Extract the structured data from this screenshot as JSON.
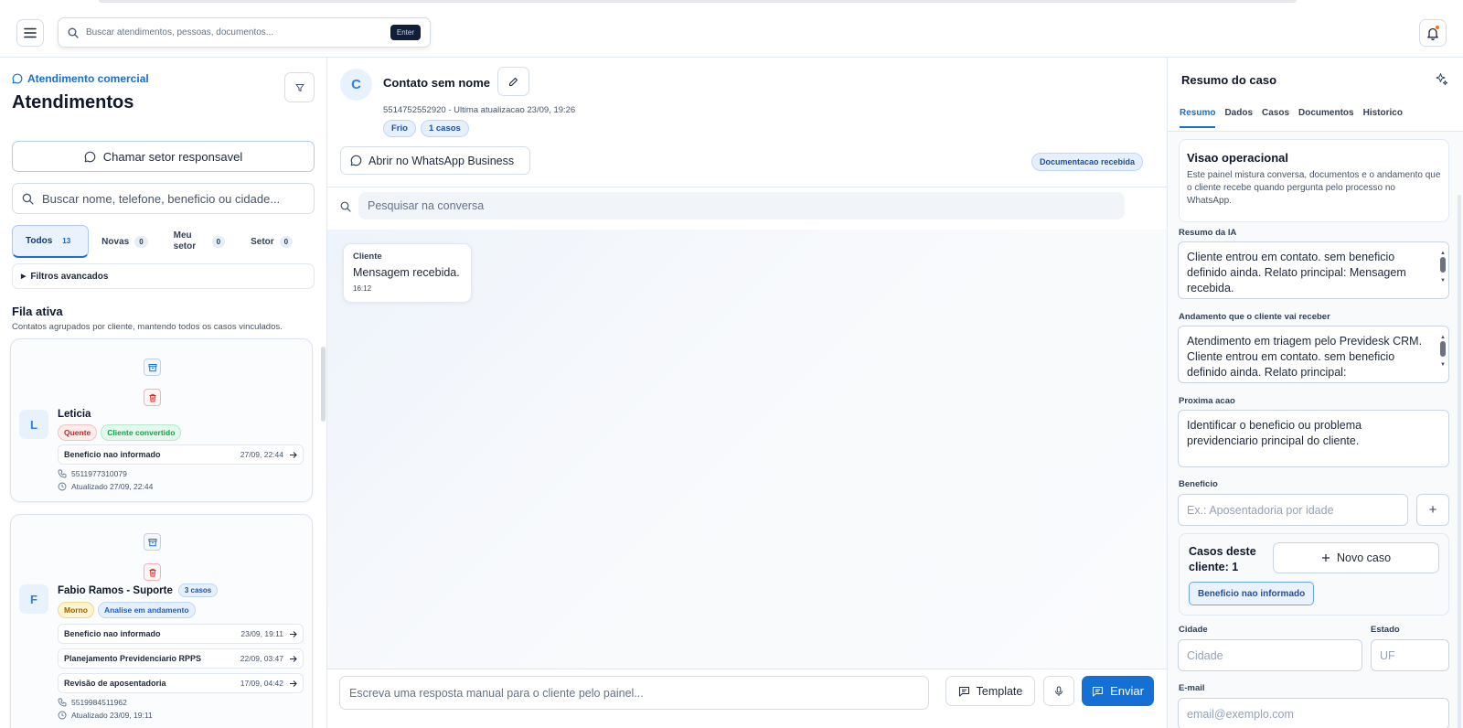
{
  "topbar": {
    "search_placeholder": "Buscar atendimentos, pessoas, documentos...",
    "enter_label": "Enter"
  },
  "sidebar": {
    "sector_label": "Atendimento comercial",
    "title": "Atendimentos",
    "call_button": "Chamar setor responsavel",
    "search_placeholder": "Buscar nome, telefone, beneficio ou cidade...",
    "tabs": [
      {
        "label": "Todos",
        "count": "13",
        "active": true
      },
      {
        "label": "Novas",
        "count": "0"
      },
      {
        "label": "Meu setor",
        "count": "0"
      },
      {
        "label": "Setor",
        "count": "0"
      }
    ],
    "advanced_filters": "Filtros avancados",
    "queue_title": "Fila ativa",
    "queue_subtitle": "Contatos agrupados por cliente, mantendo todos os casos vinculados.",
    "contacts": [
      {
        "initial": "L",
        "name": "Leticia",
        "cases_badge": "",
        "tags": [
          {
            "label": "Quente",
            "type": "hot"
          },
          {
            "label": "Cliente convertido",
            "type": "conv"
          }
        ],
        "cases": [
          {
            "name": "Beneficio nao informado",
            "date": "27/09, 22:44"
          }
        ],
        "phone": "5511977310079",
        "updated": "Atualizado 27/09, 22:44"
      },
      {
        "initial": "F",
        "name": "Fabio Ramos - Suporte",
        "cases_badge": "3 casos",
        "tags": [
          {
            "label": "Morno",
            "type": "warm"
          },
          {
            "label": "Analise em andamento",
            "type": "ana"
          }
        ],
        "cases": [
          {
            "name": "Beneficio nao informado",
            "date": "23/09, 19:11"
          },
          {
            "name": "Planejamento Previdenciario RPPS",
            "date": "22/09, 03:47"
          },
          {
            "name": "Revisão de aposentadoria",
            "date": "17/09, 04:42"
          }
        ],
        "phone": "5519984511962",
        "updated": "Atualizado 23/09, 19:11"
      }
    ]
  },
  "conversation": {
    "avatar_initial": "C",
    "contact_name": "Contato sem nome",
    "subtitle": "5514752552920 - Ultima atualizacao 23/09, 19:26",
    "chips": [
      "Frio",
      "1 casos"
    ],
    "whatsapp_button": "Abrir no WhatsApp Business",
    "doc_badge": "Documentacao recebida",
    "search_placeholder": "Pesquisar na conversa",
    "messages": [
      {
        "sender": "Cliente",
        "text": "Mensagem recebida.",
        "time": "16:12"
      }
    ],
    "composer_placeholder": "Escreva uma resposta manual para o cliente pelo painel...",
    "template_button": "Template",
    "send_button": "Enviar"
  },
  "case_panel": {
    "title": "Resumo do caso",
    "tabs": [
      "Resumo",
      "Dados",
      "Casos",
      "Documentos",
      "Historico"
    ],
    "active_tab": "Resumo",
    "op_title": "Visao operacional",
    "op_desc": "Este painel mistura conversa, documentos e o andamento que o cliente recebe quando pergunta pelo processo no WhatsApp.",
    "ai_summary_label": "Resumo da IA",
    "ai_summary": "Cliente entrou em contato. sem beneficio definido ainda. Relato principal: Mensagem recebida.",
    "progress_label": "Andamento que o cliente vai receber",
    "progress": "Atendimento em triagem pelo Previdesk CRM. Cliente entrou em contato. sem beneficio definido ainda. Relato principal:",
    "next_action_label": "Proxima acao",
    "next_action": "Identificar o beneficio ou problema previdenciario principal do cliente.",
    "benefit_label": "Beneficio",
    "benefit_placeholder": "Ex.: Aposentadoria por idade",
    "plus_label": "+",
    "cases_title": "Casos deste cliente: 1",
    "new_case_button": "Novo caso",
    "case_chip": "Beneficio nao informado",
    "city_label": "Cidade",
    "city_placeholder": "Cidade",
    "state_label": "Estado",
    "state_placeholder": "UF",
    "email_label": "E-mail",
    "email_placeholder": "email@exemplo.com"
  },
  "colors": {
    "accent": "#1570d6",
    "hot": "#c62828",
    "converted": "#16a34a",
    "warm": "#946300"
  }
}
